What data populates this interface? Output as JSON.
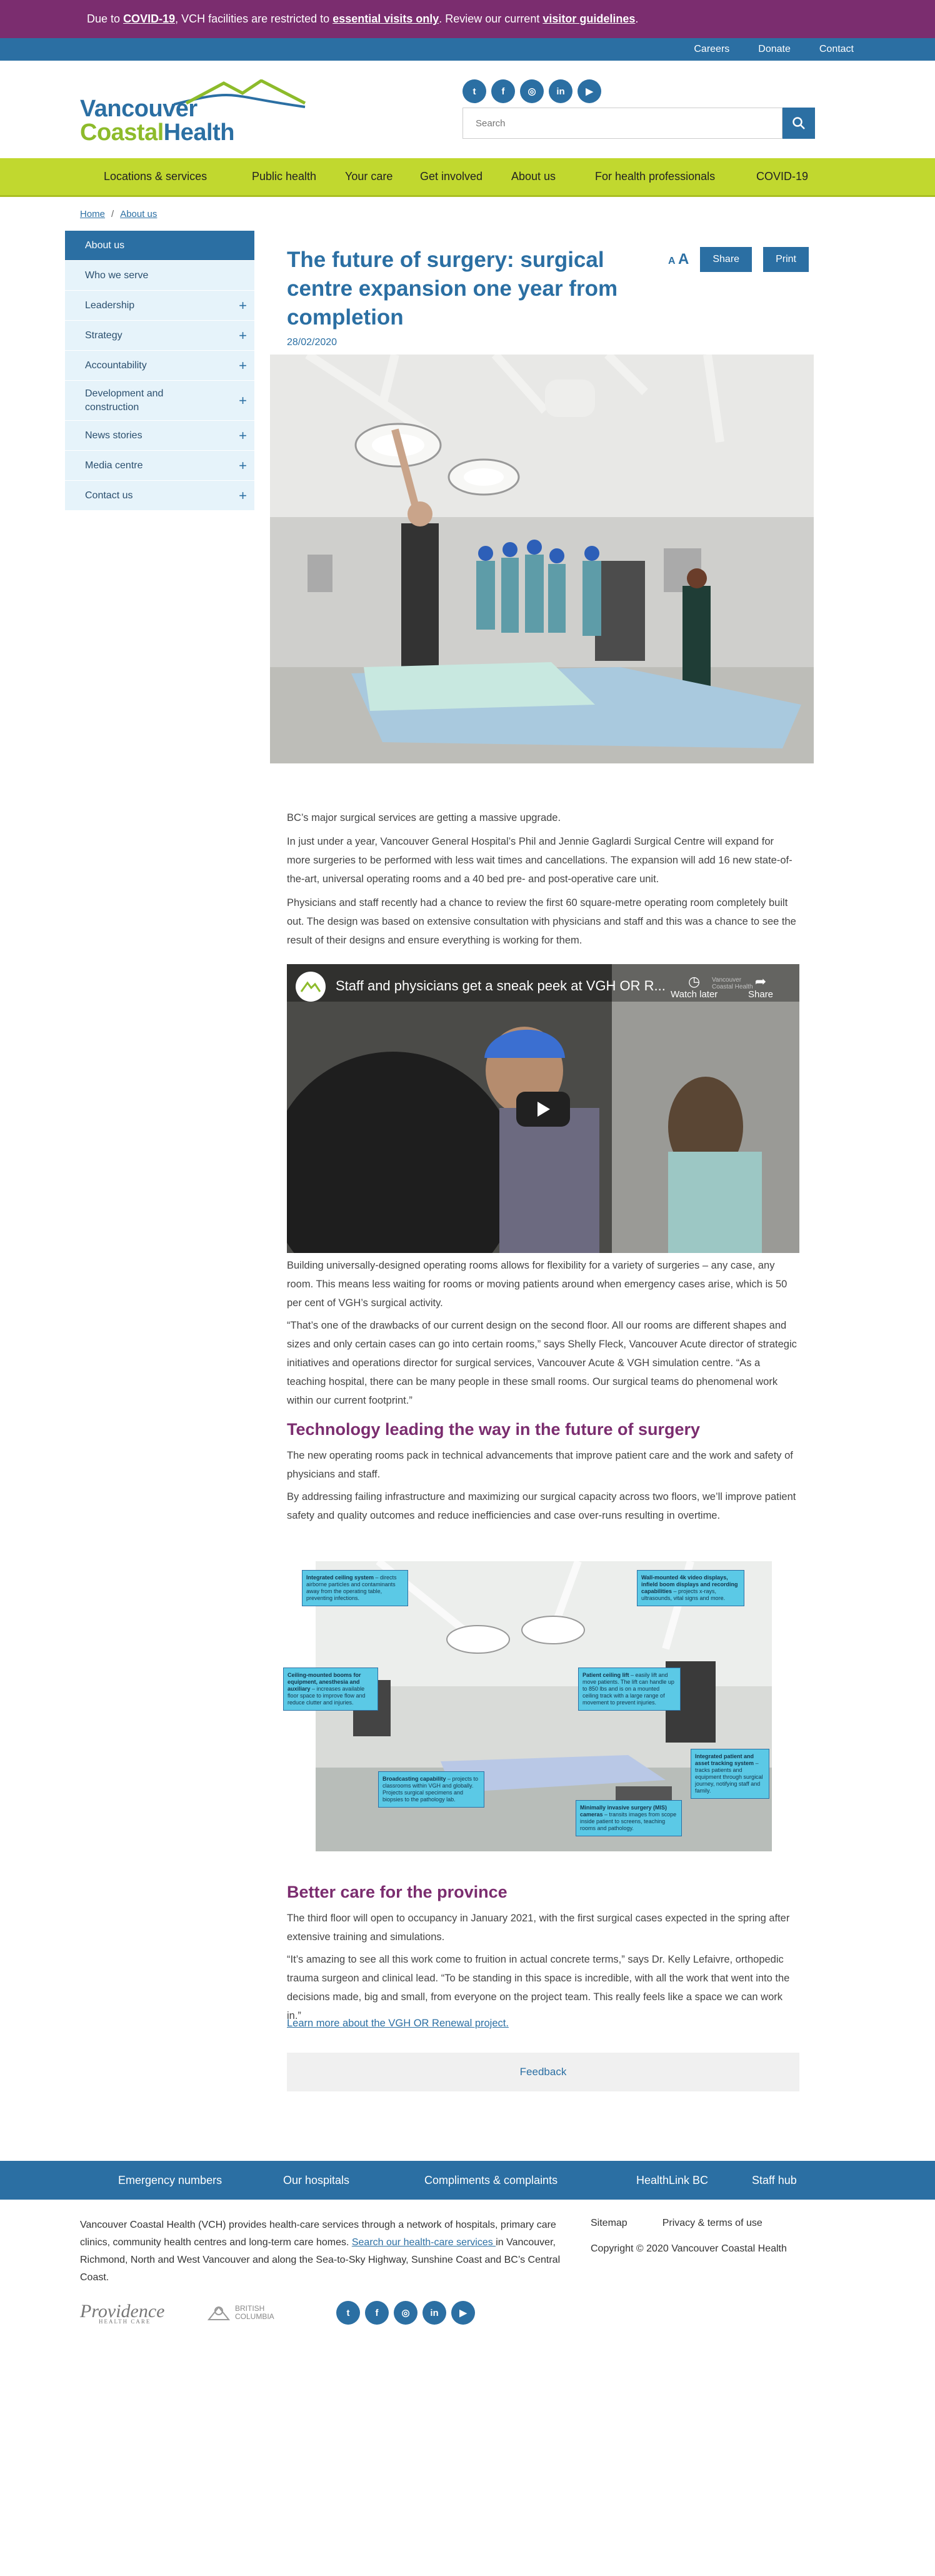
{
  "alert": {
    "prefix": "Due to ",
    "covid": "COVID-19",
    "middle": ", VCH facilities are restricted to ",
    "essential": "essential visits only",
    "middle2": ". Review our current ",
    "guidelines": "visitor guidelines",
    "suffix": "."
  },
  "utility": [
    "Careers",
    "Donate",
    "Contact"
  ],
  "logo": {
    "line1": "Vancouver",
    "line2a": "Coastal",
    "line2b": "Health"
  },
  "social": [
    "twitter-icon",
    "facebook-icon",
    "instagram-icon",
    "linkedin-icon",
    "youtube-icon"
  ],
  "social_glyphs": [
    "t",
    "f",
    "◎",
    "in",
    "▶"
  ],
  "search": {
    "placeholder": "Search"
  },
  "nav": [
    "Locations & services",
    "Public health",
    "Your care",
    "Get involved",
    "About us",
    "For health professionals",
    "COVID-19"
  ],
  "breadcrumb": [
    "Home",
    "About us"
  ],
  "sidebar": [
    {
      "label": "About us",
      "plus": false,
      "active": true
    },
    {
      "label": "Who we serve",
      "plus": false
    },
    {
      "label": "Leadership",
      "plus": true
    },
    {
      "label": "Strategy",
      "plus": true
    },
    {
      "label": "Accountability",
      "plus": true
    },
    {
      "label": "Development and construction",
      "plus": true
    },
    {
      "label": "News stories",
      "plus": true
    },
    {
      "label": "Media centre",
      "plus": true
    },
    {
      "label": "Contact us",
      "plus": true
    }
  ],
  "article": {
    "title": "The future of surgery: surgical centre expansion one year from completion",
    "font_small": "A",
    "font_large": "A",
    "share": "Share",
    "print": "Print",
    "date": "28/02/2020",
    "p1": "BC’s major surgical services are getting a massive upgrade.",
    "p2": "In just under a year, Vancouver General Hospital’s Phil and Jennie Gaglardi Surgical Centre will expand for more surgeries to be performed with less wait times and cancellations. The expansion will add 16 new state-of-the-art, universal operating rooms and a 40 bed pre- and post-operative care unit.",
    "p3": "Physicians and staff recently had a chance to review the first 60 square-metre operating room completely built out. The design was based on extensive consultation with physicians and staff and this was a chance to see the result of their designs and ensure everything is working for them.",
    "video": {
      "title": "Staff and physicians get a sneak peek at VGH OR R...",
      "watch_later": "Watch later",
      "share": "Share",
      "channel": "Vancouver Coastal Health"
    },
    "p4": "Building universally-designed operating rooms allows for flexibility for a variety of surgeries – any case, any room. This means less waiting for rooms or moving patients around when emergency cases arise, which is 50 per cent of VGH’s surgical activity.",
    "p5": "“That’s one of the drawbacks of our current design on the second floor. All our rooms are different shapes and sizes and only certain cases can go into certain rooms,” says Shelly Fleck, Vancouver Acute director of strategic initiatives and operations director for surgical services, Vancouver Acute & VGH simulation centre. “As a teaching hospital, there can be many people in these small rooms. Our surgical teams do phenomenal work within our current footprint.”",
    "h2a": "Technology leading the way in the future of surgery",
    "p6": "The new operating rooms pack in technical advancements that improve patient care and the work and safety of physicians and staff.",
    "p7": "By addressing failing infrastructure and maximizing our surgical capacity across two floors, we’ll improve patient safety and quality outcomes and reduce inefficiencies and case over-runs resulting in overtime.",
    "callouts": [
      {
        "title": "Integrated ceiling system",
        "text": " – directs airborne particles and contaminants away from the operating table, preventing infections."
      },
      {
        "title": "Wall-mounted 4k video displays, infield boom displays and recording capabilities",
        "text": " – projects x-rays, ultrasounds, vital signs and more."
      },
      {
        "title": "Ceiling-mounted booms for equipment, anesthesia and auxiliary",
        "text": " – increases available floor space to improve flow and reduce clutter and injuries."
      },
      {
        "title": "Patient ceiling lift",
        "text": " – easily lift and move patients. The lift can handle up to 850 lbs and is on a mounted ceiling track with a large range of movement to prevent injuries."
      },
      {
        "title": "Integrated patient and asset tracking system",
        "text": " – tracks patients and equipment through surgical journey, notifying staff and family."
      },
      {
        "title": "Broadcasting capability",
        "text": " – projects to classrooms within VGH and globally. Projects surgical specimens and biopsies to the pathology lab."
      },
      {
        "title": "Minimally invasive surgery (MIS) cameras",
        "text": " – transits images from scope inside patient to screens, teaching rooms and pathology."
      }
    ],
    "h2b": "Better care for the province",
    "p8": "The third floor will open to occupancy in January 2021, with the first surgical cases expected in the spring after extensive training and simulations.",
    "p9": "“It’s amazing to see all this work come to fruition in actual concrete terms,” says Dr. Kelly Lefaivre, orthopedic trauma surgeon and clinical lead. “To be standing in this space is incredible, with all the work that went into the decisions made, big and small, from everyone on the project team. This really feels like a space we can work in.”",
    "learn_more": "Learn more about the VGH OR Renewal project.",
    "feedback": "Feedback"
  },
  "footer": {
    "nav": [
      "Emergency numbers",
      "Our hospitals",
      "Compliments & complaints",
      "HealthLink BC",
      "Staff hub"
    ],
    "text1": "Vancouver Coastal Health (VCH) provides health-care services through a network of hospitals, primary care clinics, community health centres and long-term care homes. ",
    "text_link": "Search our health-care services ",
    "text2": "in Vancouver, Richmond, North and West Vancouver and along the Sea-to-Sky Highway, Sunshine Coast and BC’s Central Coast.",
    "links": [
      "Sitemap",
      "Privacy & terms of use"
    ],
    "copyright": "Copyright © 2020 Vancouver Coastal Health",
    "providence": "Providence",
    "providence_sub": "HEALTH CARE",
    "bc_line1": "BRITISH",
    "bc_line2": "COLUMBIA"
  },
  "colors": {
    "brand_blue": "#2b6fa3",
    "brand_green": "#c1d82f",
    "alert_purple": "#7b2d6f",
    "heading_purple": "#7b2d6f"
  }
}
